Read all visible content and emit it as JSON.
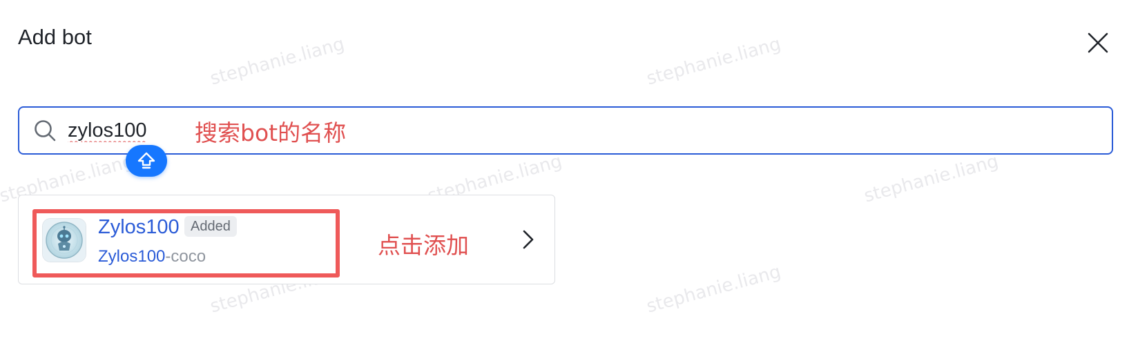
{
  "dialog": {
    "title": "Add bot",
    "close_icon": "close-icon"
  },
  "search": {
    "icon": "search-icon",
    "value": "zylos100",
    "annotation": "搜索bot的名称",
    "shift_badge_icon": "shift-key-icon"
  },
  "result": {
    "avatar_icon": "robot-avatar",
    "name": "Zylos100",
    "badge": "Added",
    "subtitle_highlight": "Zylos100",
    "subtitle_rest": "-coco",
    "annotation": "点击添加",
    "chevron_icon": "chevron-right-icon"
  },
  "watermark": {
    "text": "stephanie.liang"
  },
  "colors": {
    "accent": "#2a5bd7",
    "annotation_red": "#e05050",
    "shift_badge_blue": "#1677ff"
  }
}
